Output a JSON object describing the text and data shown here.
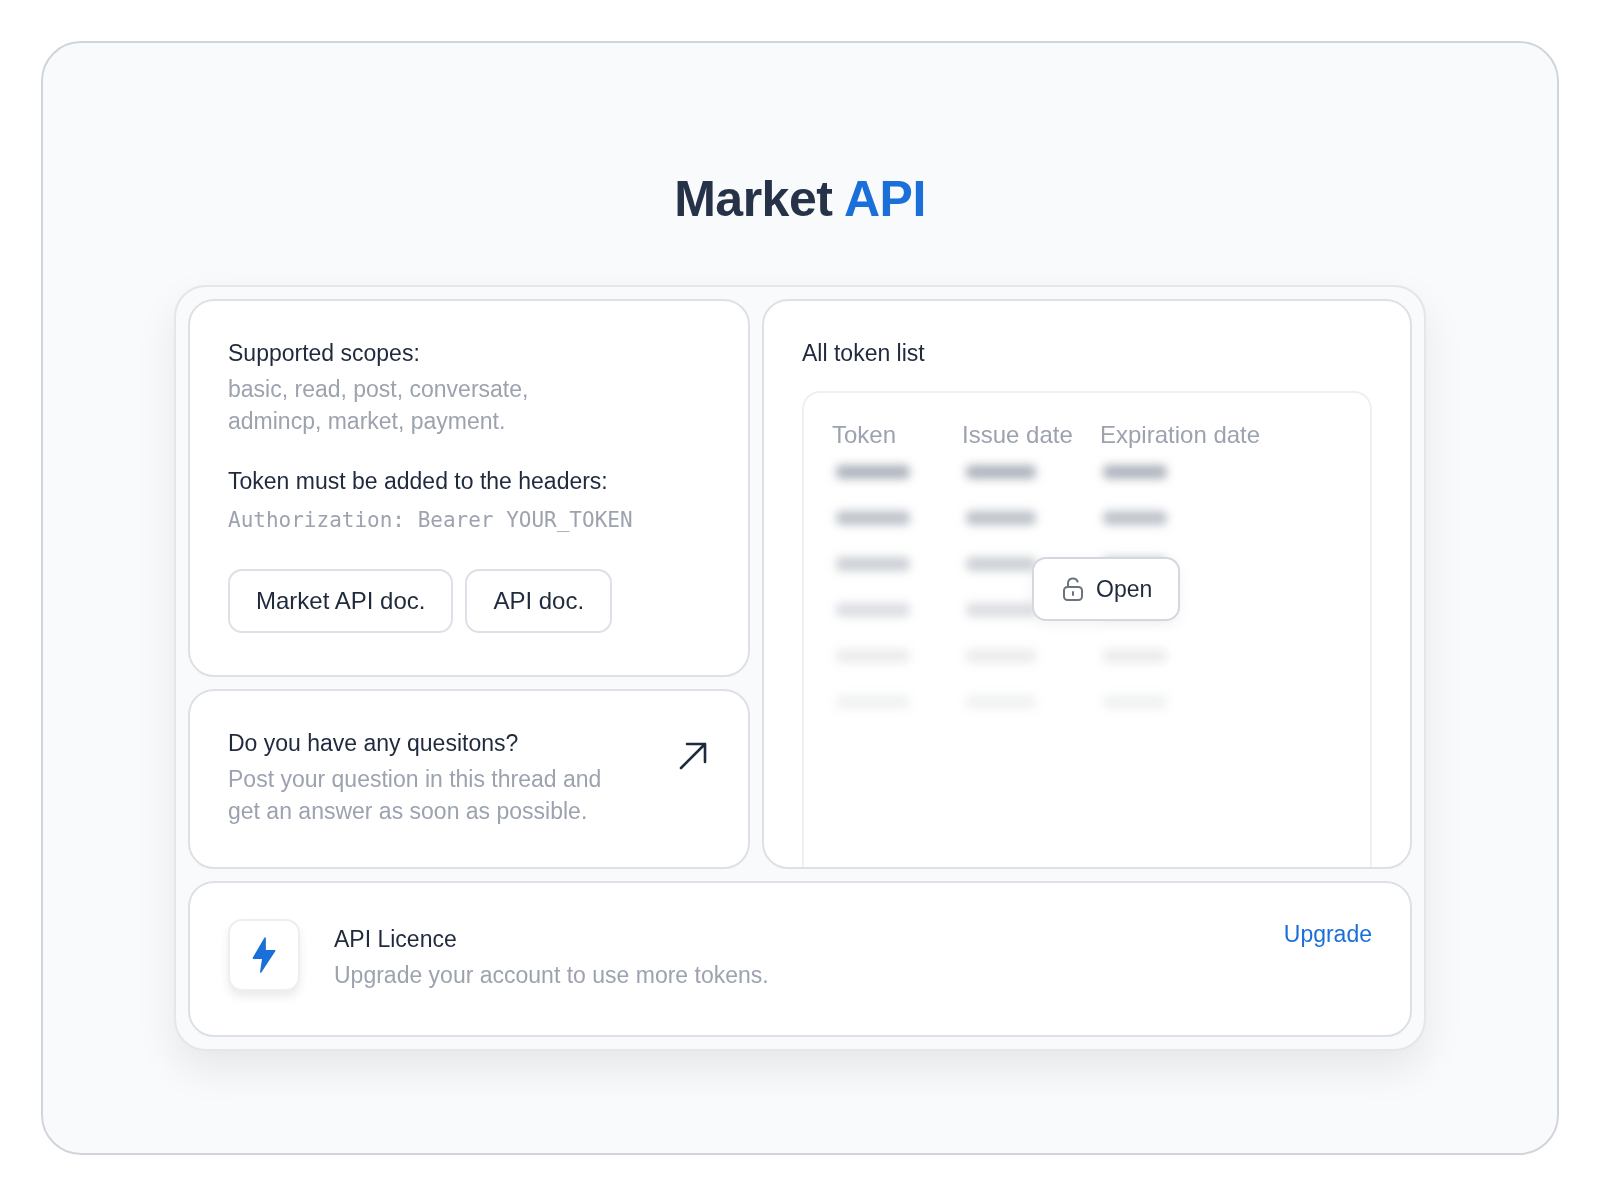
{
  "title": {
    "text": "Market",
    "accent": "API"
  },
  "info": {
    "scopes_label": "Supported scopes:",
    "scopes": "basic, read, post, conversate,\nadmincp, market, payment.",
    "header_label": "Token must be added to the headers:",
    "header_code": "Authorization: Bearer YOUR_TOKEN",
    "buttons": [
      "Market API doc.",
      "API doc."
    ]
  },
  "questions": {
    "title": "Do you have any quesitons?",
    "text": "Post your question in this thread and\nget an answer as soon as possible."
  },
  "tokens": {
    "title": "All token list",
    "columns": [
      "Token",
      "Issue date",
      "Expiration date"
    ],
    "locked": true,
    "open_button": "Open"
  },
  "licence": {
    "title": "API Licence",
    "text": "Upgrade your account to use more tokens.",
    "link": "Upgrade"
  }
}
